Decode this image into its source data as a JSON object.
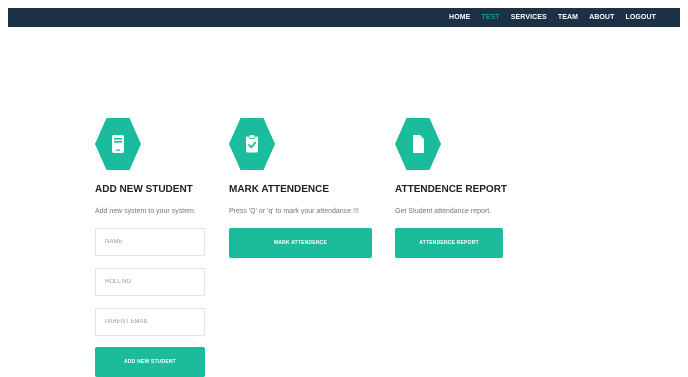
{
  "nav": {
    "items": [
      {
        "label": "HOME",
        "active": false
      },
      {
        "label": "TEST",
        "active": true
      },
      {
        "label": "SERVICES",
        "active": false
      },
      {
        "label": "TEAM",
        "active": false
      },
      {
        "label": "ABOUT",
        "active": false
      },
      {
        "label": "LOGOUT",
        "active": false
      }
    ]
  },
  "cards": {
    "add_student": {
      "icon": "mobile-device-icon",
      "title": "ADD NEW STUDENT",
      "description": "Add new system to your system.",
      "fields": {
        "name_placeholder": "NAME",
        "roll_placeholder": "ROLL NO",
        "email_placeholder": "PARENT EMAIL"
      },
      "button_label": "ADD NEW STUDENT"
    },
    "mark_attendance": {
      "icon": "clipboard-check-icon",
      "title": "MARK ATTENDENCE",
      "description": "Press 'Q' or 'q' to mark your attendance !!!",
      "button_label": "MARK ATTENDENCE"
    },
    "report": {
      "icon": "document-icon",
      "title": "ATTENDENCE REPORT",
      "description": "Get Student attendance report.",
      "button_label": "ATTENDENCE REPORT"
    }
  },
  "colors": {
    "navbar": "#1c3146",
    "accent": "#1abc9c"
  }
}
